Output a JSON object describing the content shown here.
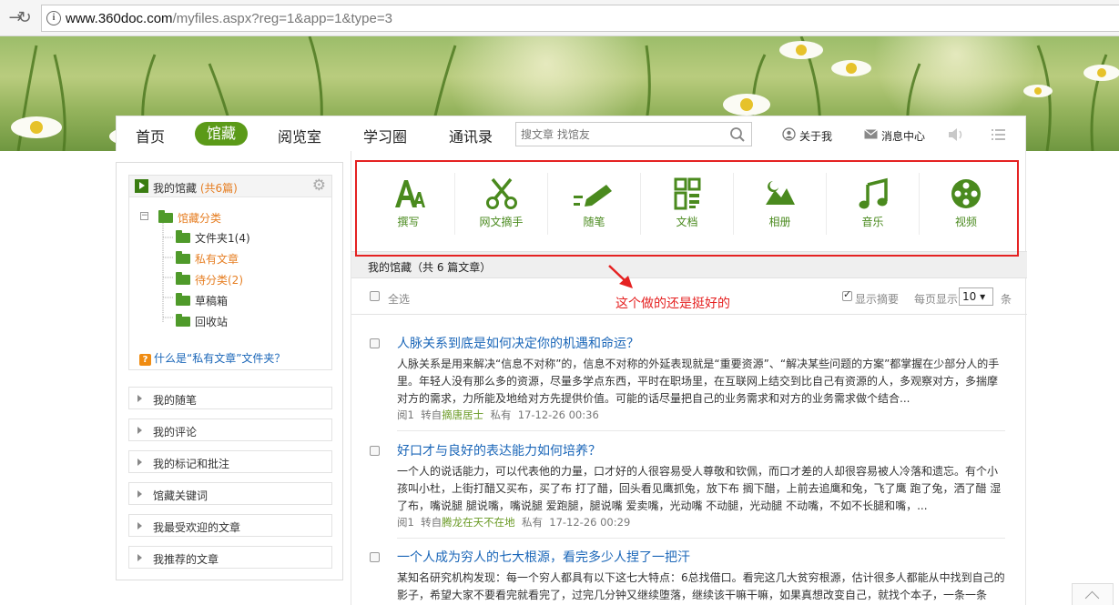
{
  "browser": {
    "url_host": "www.360doc.com",
    "url_path": "/myfiles.aspx?reg=1&app=1&type=3"
  },
  "topnav": {
    "items": [
      "首页",
      "馆藏",
      "阅览室",
      "学习圈",
      "通讯录"
    ],
    "active": "馆藏",
    "search_placeholder": "搜文章 找馆友",
    "about": "关于我",
    "messages": "消息中心"
  },
  "sidebar": {
    "my_collection": "我的馆藏",
    "my_collection_count": "(共6篇)",
    "tree_root": "馆藏分类",
    "folders": [
      "文件夹1(4)",
      "私有文章",
      "待分类(2)",
      "草稿箱",
      "回收站"
    ],
    "help_link": "什么是“私有文章”文件夹？",
    "menu": [
      "我的随笔",
      "我的评论",
      "我的标记和批注",
      "馆藏关键词",
      "我最受欢迎的文章",
      "我推荐的文章"
    ]
  },
  "tools": [
    {
      "label": "撰写",
      "icon": "write-icon"
    },
    {
      "label": "网文摘手",
      "icon": "scissors-icon"
    },
    {
      "label": "随笔",
      "icon": "pencil-icon"
    },
    {
      "label": "文档",
      "icon": "document-icon"
    },
    {
      "label": "相册",
      "icon": "album-icon"
    },
    {
      "label": "音乐",
      "icon": "music-icon"
    },
    {
      "label": "视频",
      "icon": "video-icon"
    }
  ],
  "list": {
    "header": "我的馆藏（共 6 篇文章）",
    "select_all": "全选",
    "show_summary": "显示摘要",
    "per_page_label": "每页显示",
    "per_page_value": "10 ▾",
    "per_page_unit": "条"
  },
  "annotation": "这个做的还是挺好的",
  "articles": [
    {
      "title": "人脉关系到底是如何决定你的机遇和命运？",
      "summary": "人脉关系是用来解决“信息不对称”的，信息不对称的外延表现就是“重要资源”、“解决某些问题的方案”都掌握在少部分人的手里。年轻人没有那么多的资源，尽量多学点东西，平时在职场里，在互联网上结交到比自己有资源的人，多观察对方，多揣摩对方的需求，力所能及地给对方先提供价值。可能的话尽量把自己的业务需求和对方的业务需求做个结合...",
      "reads": "阅1",
      "from_label": "转自",
      "source": "摘唐居士",
      "privacy": "私有",
      "date": "17-12-26 00:36"
    },
    {
      "title": "好口才与良好的表达能力如何培养？",
      "summary": "一个人的说话能力，可以代表他的力量，口才好的人很容易受人尊敬和钦佩，而口才差的人却很容易被人冷落和遗忘。有个小孩叫小杜，上街打醋又买布，买了布 打了醋，回头看见鹰抓兔，放下布 搁下醋，上前去追鹰和兔，飞了鹰 跑了兔，洒了醋 湿了布，嘴说腿 腿说嘴，嘴说腿 爱跑腿，腿说嘴 爱卖嘴，光动嘴 不动腿，光动腿 不动嘴，不如不长腿和嘴，...",
      "reads": "阅1",
      "from_label": "转自",
      "source": "腾龙在天不在地",
      "privacy": "私有",
      "date": "17-12-26 00:29"
    },
    {
      "title": "一个人成为穷人的七大根源，看完多少人捏了一把汗",
      "summary": "某知名研究机构发现：每一个穷人都具有以下这七大特点：6总找借口。看完这几大贫穷根源，估计很多人都能从中找到自己的影子，希望大家不要看完就看完了，过完几分钟又继续堕落，继续该干嘛干嘛，如果真想改变自己，就找个本子，一条一条"
    }
  ]
}
